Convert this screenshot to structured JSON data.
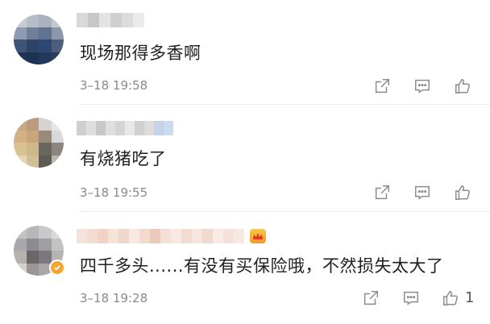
{
  "comments": [
    {
      "text": "现场那得多香啊",
      "time": "3–18 19:58",
      "like_count": "",
      "avatar_icon": "blurred-avatar",
      "username_icon": "blurred-username"
    },
    {
      "text": "有烧猪吃了",
      "time": "3–18 19:55",
      "like_count": "",
      "avatar_icon": "blurred-avatar",
      "username_icon": "blurred-username"
    },
    {
      "text": "四千多头......有没有买保险哦，不然损失太大了",
      "time": "3–18 19:28",
      "like_count": "1",
      "avatar_icon": "blurred-avatar",
      "username_icon": "blurred-username",
      "verified_icon": "verified-badge-icon",
      "member_badge_icon": "vip-crown-badge-icon"
    }
  ],
  "actions": {
    "share_icon": "share-icon",
    "comment_icon": "comment-icon",
    "like_icon": "thumbs-up-icon"
  },
  "colors": {
    "text": "#1f1f1f",
    "time": "#8a8a8a",
    "icon": "#8c8c8c",
    "verified": "#f2a733"
  }
}
